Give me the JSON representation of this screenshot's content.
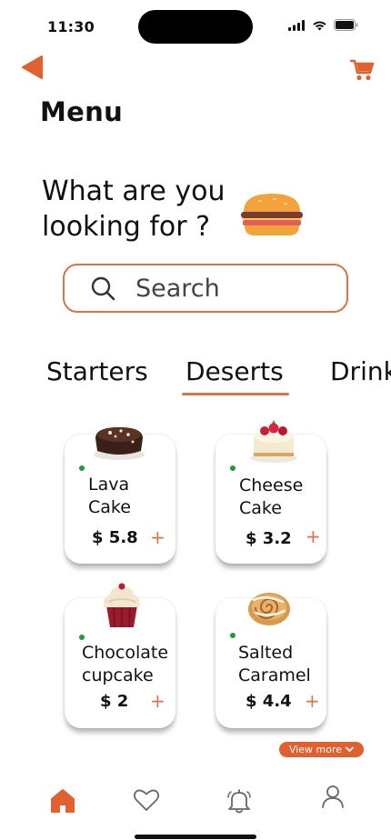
{
  "status_bar": {
    "time": "11:30"
  },
  "header": {
    "title": "Menu"
  },
  "hero": {
    "line1": "What are you",
    "line2": "looking for ?"
  },
  "search": {
    "placeholder": "Search"
  },
  "categories": [
    {
      "label": "Starters",
      "active": false
    },
    {
      "label": "Deserts",
      "active": true
    },
    {
      "label": "Drinks",
      "active": false
    }
  ],
  "items": [
    {
      "name_line1": "Lava",
      "name_line2": "Cake",
      "price": "$ 5.8",
      "add": "+",
      "image": "lava-cake-image"
    },
    {
      "name_line1": "Cheese",
      "name_line2": "Cake",
      "price": "$ 3.2",
      "add": "+",
      "image": "cheesecake-image"
    },
    {
      "name_line1": "Chocolate",
      "name_line2": "cupcake",
      "price": "$ 2",
      "add": "+",
      "image": "cupcake-image"
    },
    {
      "name_line1": "Salted",
      "name_line2": "Caramel",
      "price": "$ 4.4",
      "add": "+",
      "image": "caramel-roll-image"
    }
  ],
  "view_more": {
    "label": "View more"
  },
  "bottom_nav": [
    "home-icon",
    "heart-icon",
    "bell-icon",
    "user-icon"
  ],
  "colors": {
    "accent": "#d9744a",
    "accent_dark": "#e0602f",
    "available_dot": "#1d9a3f"
  }
}
